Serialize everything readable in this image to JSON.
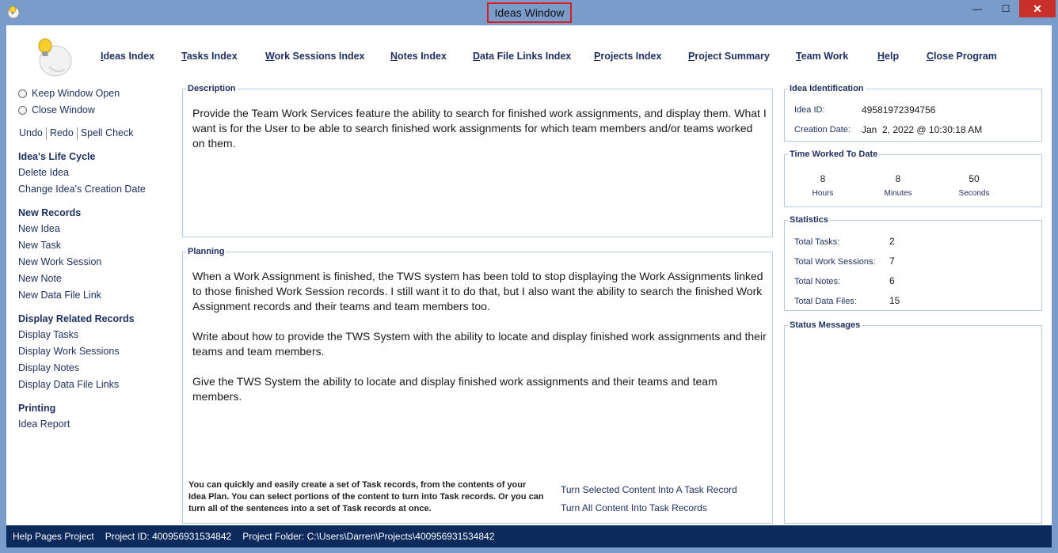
{
  "window": {
    "title": "Ideas Window",
    "min_glyph": "—",
    "max_glyph": "☐",
    "close_glyph": "✕",
    "icon": "bulb-app-icon"
  },
  "nav": {
    "items": [
      "Ideas Index",
      "Tasks Index",
      "Work Sessions Index",
      "Notes Index",
      "Data File Links Index",
      "Projects Index",
      "Project Summary",
      "Team Work",
      "Help",
      "Close Program"
    ]
  },
  "sidebar": {
    "keep_open": "Keep Window Open",
    "close_window": "Close Window",
    "undo": "Undo",
    "redo": "Redo",
    "spell_check": "Spell Check",
    "lifecycle_head": "Idea's Life Cycle",
    "delete_idea": "Delete Idea",
    "change_date": "Change Idea's Creation Date",
    "new_records_head": "New Records",
    "new_idea": "New Idea",
    "new_task": "New Task",
    "new_work_session": "New Work Session",
    "new_note": "New Note",
    "new_data_file_link": "New Data File Link",
    "display_head": "Display Related Records",
    "display_tasks": "Display Tasks",
    "display_work_sessions": "Display Work Sessions",
    "display_notes": "Display Notes",
    "display_data_file_links": "Display Data File Links",
    "printing_head": "Printing",
    "idea_report": "Idea Report"
  },
  "description": {
    "legend": "Description",
    "text": "Provide the Team Work Services feature the ability to search for finished work assignments, and display them. What I want is for the User to be able to search finished work assignments for which team members and/or teams worked on them."
  },
  "planning": {
    "legend": "Planning",
    "paragraphs": [
      "When a Work Assignment is finished, the TWS system has been told to stop displaying the Work Assignments linked to those finished Work Session records. I still want it to do that, but I also want the ability to search the finished Work Assignment records and their teams and team members too.",
      "Write about how to provide the TWS System with the ability to locate and display finished work assignments and their teams and team members.",
      "Give the TWS System the ability to locate and display finished work assignments and their teams and team members."
    ],
    "hint": "You can quickly and easily create a set of Task records, from the contents of your Idea Plan. You can select portions of the content to turn into Task records. Or you can turn all of the sentences into a set of Task records at once.",
    "selected_to_task": "Turn Selected Content Into A Task Record",
    "all_to_tasks": "Turn All Content Into Task Records"
  },
  "identification": {
    "legend": "Idea Identification",
    "id_label": "Idea ID:",
    "id_value": "49581972394756",
    "date_label": "Creation Date:",
    "date_value": "Jan  2, 2022 @ 10:30:18 AM"
  },
  "time_worked": {
    "legend": "Time Worked To Date",
    "hours": "8",
    "hours_label": "Hours",
    "minutes": "8",
    "minutes_label": "Minutes",
    "seconds": "50",
    "seconds_label": "Seconds"
  },
  "statistics": {
    "legend": "Statistics",
    "tasks_label": "Total Tasks:",
    "tasks": "2",
    "sessions_label": "Total Work Sessions:",
    "sessions": "7",
    "notes_label": "Total Notes:",
    "notes": "6",
    "files_label": "Total Data Files:",
    "files": "15"
  },
  "status_messages": {
    "legend": "Status Messages"
  },
  "statusbar": {
    "project": "Help Pages Project",
    "project_id": "Project ID:  400956931534842",
    "project_folder": "Project Folder: C:\\Users\\Darren\\Projects\\400956931534842"
  }
}
